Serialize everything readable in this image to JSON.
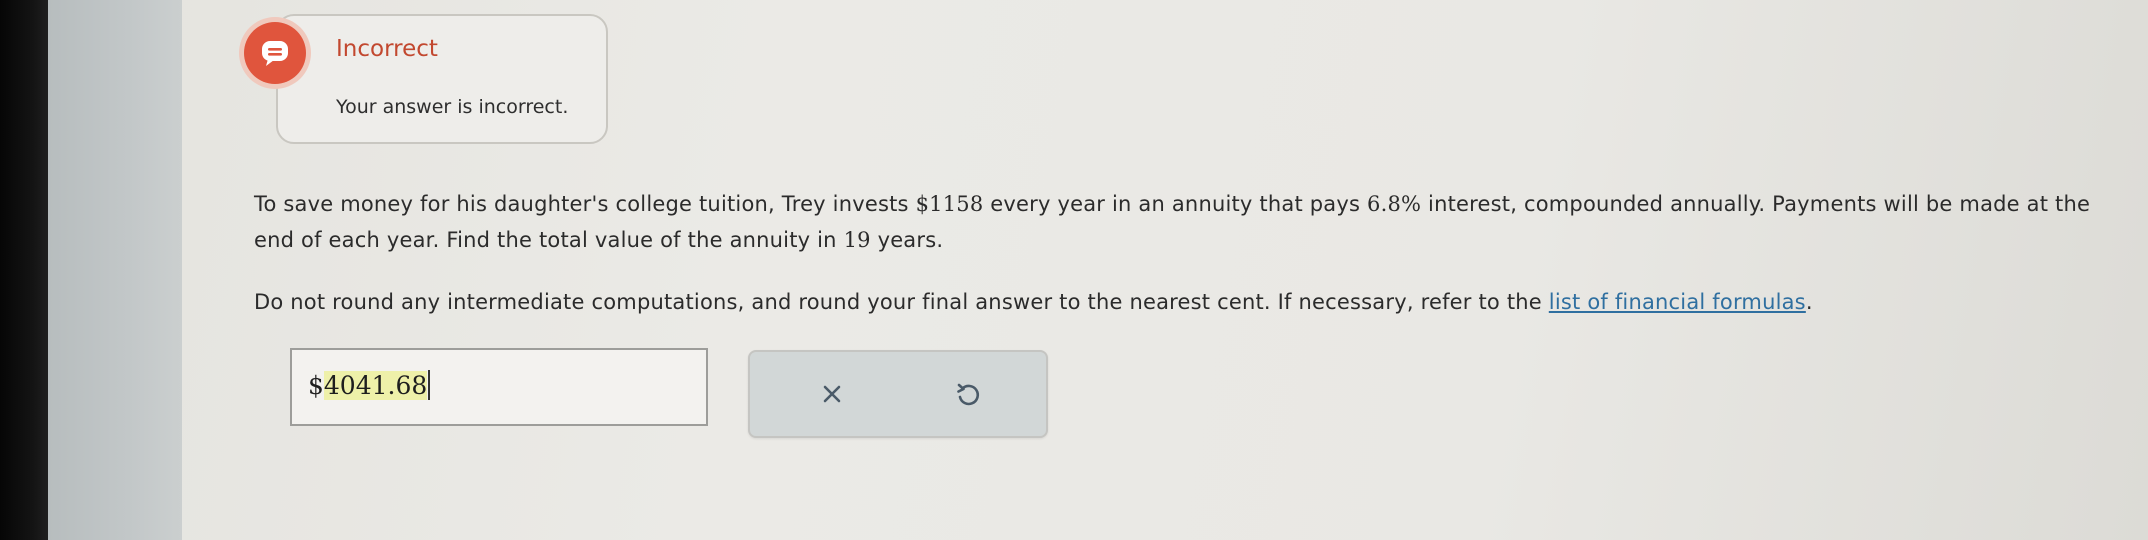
{
  "feedback": {
    "status": "Incorrect",
    "message": "Your answer is incorrect.",
    "icon": "chat-bubble-icon",
    "color": "#e0553d"
  },
  "question": {
    "part1": "To save money for his daughter's college tuition, Trey invests ",
    "amount": "$1158",
    "part2": " every year in an annuity that pays ",
    "rate": "6.8%",
    "part3": " interest, compounded annually. Payments will be made at the end of each year. Find the total value of the annuity in ",
    "years": "19",
    "part4": " years."
  },
  "instructions": {
    "text": "Do not round any intermediate computations, and round your final answer to the nearest cent. If necessary, refer to the ",
    "link_label": "list of financial formulas",
    "trailing": "."
  },
  "answer": {
    "currency": "$",
    "value": "4041.68"
  },
  "actions": {
    "clear_icon": "close-icon",
    "undo_icon": "undo-icon"
  }
}
